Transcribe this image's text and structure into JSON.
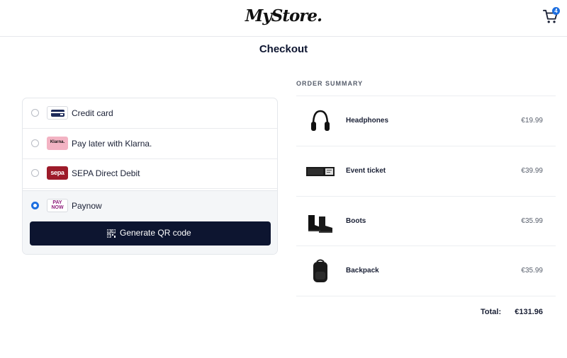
{
  "header": {
    "logo_text": "MyStore.",
    "cart_count": "4",
    "cart_icon": "cart-icon"
  },
  "page": {
    "title": "Checkout"
  },
  "payment": {
    "methods": [
      {
        "label": "Credit card",
        "icon": "credit-card-icon",
        "selected": false
      },
      {
        "label": "Pay later with Klarna.",
        "icon": "klarna-logo",
        "logo_text": "Klarna.",
        "selected": false
      },
      {
        "label": "SEPA Direct Debit",
        "icon": "sepa-logo",
        "logo_text": "sepa",
        "selected": false
      },
      {
        "label": "Paynow",
        "icon": "paynow-logo",
        "logo_line1": "PAY",
        "logo_line2": "NOW",
        "selected": true
      }
    ],
    "qr_button_label": "Generate QR code",
    "qr_icon": "qr-code-icon"
  },
  "summary": {
    "heading": "ORDER SUMMARY",
    "items": [
      {
        "name": "Headphones",
        "price": "€19.99",
        "icon": "headphones-image"
      },
      {
        "name": "Event ticket",
        "price": "€39.99",
        "icon": "ticket-image"
      },
      {
        "name": "Boots",
        "price": "€35.99",
        "icon": "boots-image"
      },
      {
        "name": "Backpack",
        "price": "€35.99",
        "icon": "backpack-image"
      }
    ],
    "total_label": "Total:",
    "total_value": "€131.96"
  },
  "colors": {
    "primary_dark": "#0d1530",
    "accent_blue": "#1d6fe0",
    "klarna_pink": "#f3b3c3",
    "sepa_red": "#9d1b2a",
    "paynow_purple": "#8f1f7c"
  }
}
